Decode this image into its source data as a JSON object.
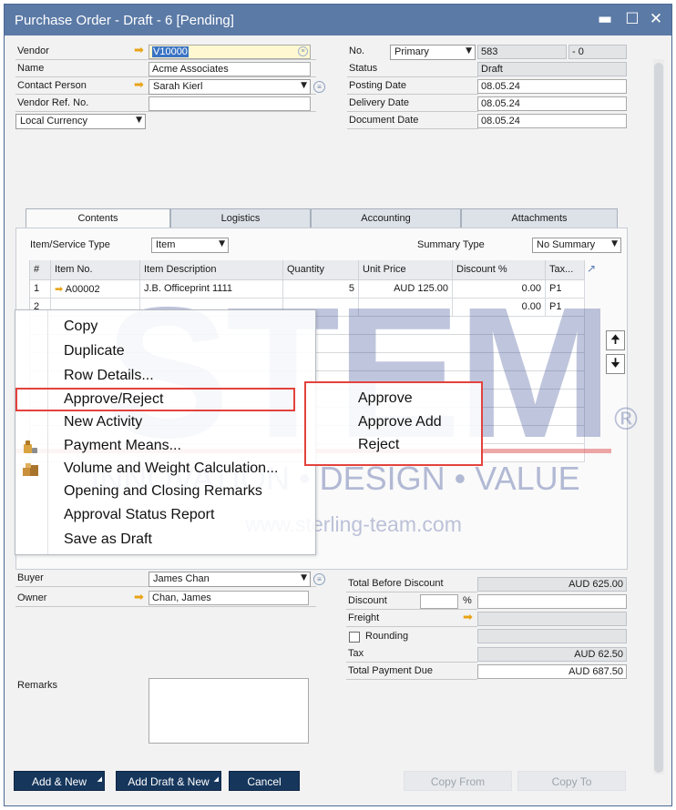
{
  "window": {
    "title": "Purchase Order - Draft - 6 [Pending]",
    "min_icon": "minimize-icon",
    "max_icon": "maximize-icon",
    "close_icon": "close-icon"
  },
  "header_left": {
    "vendor_label": "Vendor",
    "vendor_value": "V10000",
    "name_label": "Name",
    "name_value": "Acme Associates",
    "contact_label": "Contact Person",
    "contact_value": "Sarah Kierl",
    "vendor_ref_label": "Vendor Ref. No.",
    "vendor_ref_value": "",
    "currency_value": "Local Currency"
  },
  "header_right": {
    "no_label": "No.",
    "series_value": "Primary",
    "doc_no": "583",
    "doc_suffix": "- 0",
    "status_label": "Status",
    "status_value": "Draft",
    "posting_label": "Posting Date",
    "posting_value": "08.05.24",
    "delivery_label": "Delivery Date",
    "delivery_value": "08.05.24",
    "document_label": "Document Date",
    "document_value": "08.05.24"
  },
  "tabs": [
    {
      "label": "Contents"
    },
    {
      "label": "Logistics"
    },
    {
      "label": "Accounting"
    },
    {
      "label": "Attachments"
    }
  ],
  "contents": {
    "item_type_label": "Item/Service Type",
    "item_type_value": "Item",
    "summary_type_label": "Summary Type",
    "summary_type_value": "No Summary",
    "columns": [
      "#",
      "Item No.",
      "Item Description",
      "Quantity",
      "Unit Price",
      "Discount %",
      "Tax..."
    ],
    "rows": [
      {
        "num": "1",
        "item_no": "A00002",
        "desc": "J.B. Officeprint 1111",
        "qty": "5",
        "price": "AUD 125.00",
        "disc": "0.00",
        "tax": "P1"
      },
      {
        "num": "2",
        "item_no": "",
        "desc": "",
        "qty": "",
        "price": "",
        "disc": "0.00",
        "tax": "P1"
      }
    ]
  },
  "context_menu": {
    "items": [
      {
        "label": "Copy"
      },
      {
        "label": "Duplicate"
      },
      {
        "label": "Row Details..."
      },
      {
        "label": "Approve/Reject"
      },
      {
        "label": "New Activity"
      },
      {
        "label": "Payment Means..."
      },
      {
        "label": "Volume and Weight Calculation..."
      },
      {
        "label": "Opening and Closing Remarks"
      },
      {
        "label": "Approval Status Report"
      },
      {
        "label": "Save as Draft"
      }
    ],
    "submenu": [
      {
        "label": "Approve"
      },
      {
        "label": "Approve  Add"
      },
      {
        "label": "Reject"
      }
    ]
  },
  "watermark": {
    "brand": "STEM",
    "registered": "®",
    "tagline": "INNOVATION • DESIGN • VALUE",
    "url": "www.sterling-team.com"
  },
  "footer_left": {
    "buyer_label": "Buyer",
    "buyer_value": "James Chan",
    "owner_label": "Owner",
    "owner_value": "Chan, James",
    "remarks_label": "Remarks"
  },
  "totals": {
    "before_discount_label": "Total Before Discount",
    "before_discount_value": "AUD 625.00",
    "discount_label": "Discount",
    "discount_pct_sign": "%",
    "freight_label": "Freight",
    "rounding_label": "Rounding",
    "tax_label": "Tax",
    "tax_value": "AUD 62.50",
    "total_due_label": "Total Payment Due",
    "total_due_value": "AUD 687.50"
  },
  "buttons": {
    "add_new": "Add & New",
    "add_draft_new": "Add Draft & New",
    "cancel": "Cancel",
    "copy_from": "Copy From",
    "copy_to": "Copy To"
  },
  "colors": {
    "titlebar": "#5b7aa6",
    "primary_button": "#16365c",
    "highlight_red": "#e3423c",
    "watermark_blue": "#3c4f96",
    "watermark_red": "#e06060"
  }
}
